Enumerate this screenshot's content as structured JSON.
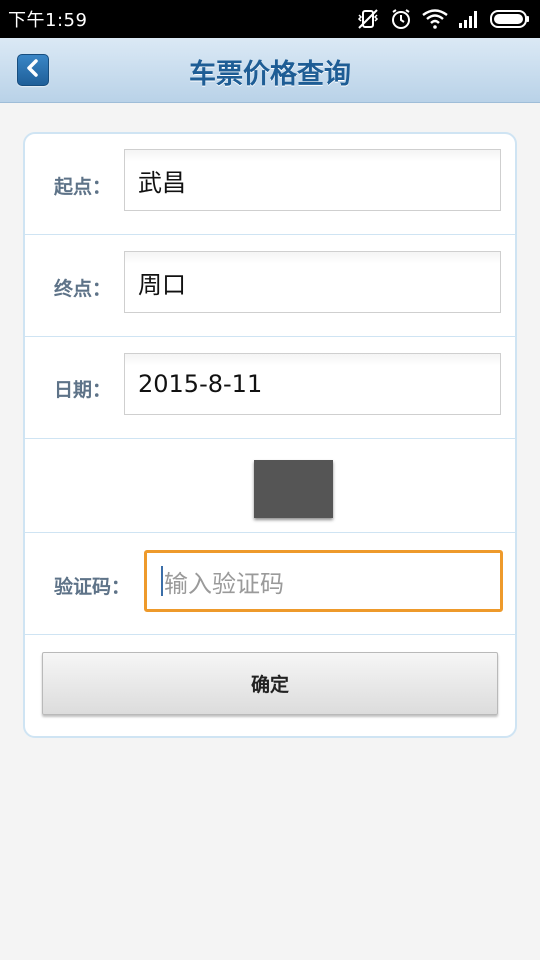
{
  "status_bar": {
    "time": "下午1:59",
    "icons": [
      "vibrate-off-icon",
      "alarm-icon",
      "wifi-icon",
      "signal-icon",
      "battery-icon"
    ]
  },
  "header": {
    "title": "车票价格查询",
    "back_icon": "chevron-left-icon",
    "accent_color": "#1e5d95"
  },
  "form": {
    "start": {
      "label": "起点：",
      "value": "武昌"
    },
    "end": {
      "label": "终点：",
      "value": "周口"
    },
    "date": {
      "label": "日期：",
      "value": "2015-8-11"
    },
    "captcha": {
      "label": "验证码：",
      "placeholder": "输入验证码",
      "focus_color": "#ee9a2b"
    },
    "submit_label": "确定"
  }
}
